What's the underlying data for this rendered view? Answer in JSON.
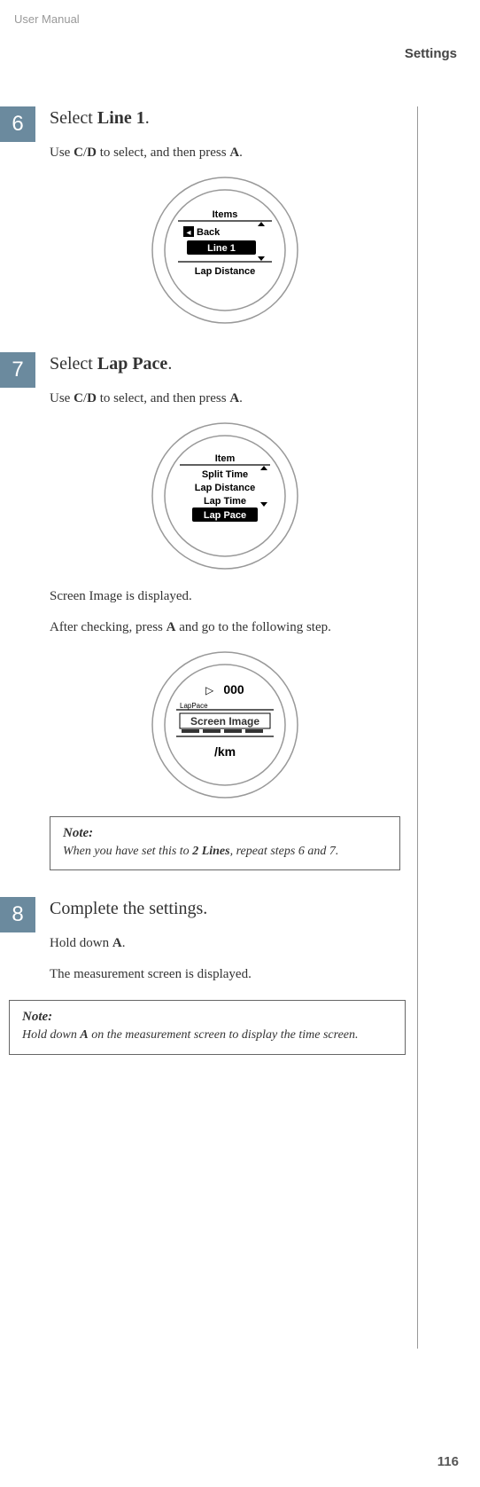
{
  "header": {
    "doc_title": "User Manual",
    "section_title": "Settings"
  },
  "steps": {
    "s6": {
      "num": "6",
      "title_pre": "Select ",
      "title_bold": "Line 1",
      "title_post": ".",
      "instr_pre": "Use ",
      "instr_b1": "C",
      "instr_mid1": "/",
      "instr_b2": "D",
      "instr_mid2": " to select, and then press ",
      "instr_b3": "A",
      "instr_post": ".",
      "device": {
        "header": "Items",
        "row1_icon": "◂",
        "row1": "Back",
        "row2_highlight": "Line 1",
        "row3": "Lap Distance"
      }
    },
    "s7": {
      "num": "7",
      "title_pre": "Select ",
      "title_bold": "Lap Pace",
      "title_post": ".",
      "instr_pre": "Use ",
      "instr_b1": "C",
      "instr_mid1": "/",
      "instr_b2": "D",
      "instr_mid2": " to select, and then press ",
      "instr_b3": "A",
      "instr_post": ".",
      "device1": {
        "header": "Item",
        "row1": "Split Time",
        "row2": "Lap Distance",
        "row3": "Lap Time",
        "row4_highlight": "Lap Pace"
      },
      "text1": "Screen Image is displayed.",
      "text2_pre": "After checking, press ",
      "text2_b": "A",
      "text2_post": " and go to the following step.",
      "device2": {
        "top_icon": "▷",
        "top_val": "000",
        "label": "LapPace",
        "mid_highlight": "Screen Image",
        "bottom": "/km"
      },
      "note": {
        "label": "Note:",
        "text_pre": "When you have set this to ",
        "text_bold": "2 Lines",
        "text_post": ", repeat steps 6 and 7."
      }
    },
    "s8": {
      "num": "8",
      "title": "Complete the settings.",
      "instr_pre": "Hold down ",
      "instr_b": "A",
      "instr_post": ".",
      "text1": "The measurement screen is displayed.",
      "note": {
        "label": "Note:",
        "text_pre": "Hold down ",
        "text_bold": "A",
        "text_post": " on the measurement screen to display the time screen."
      }
    }
  },
  "page_num": "116"
}
